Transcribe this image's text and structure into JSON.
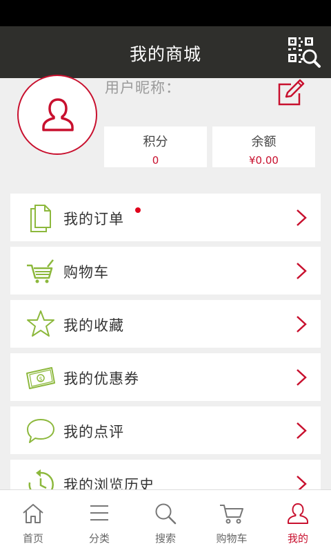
{
  "header": {
    "title": "我的商城"
  },
  "profile": {
    "nickname_label": "用户昵称："
  },
  "stats": {
    "points_label": "积分",
    "points_value": "0",
    "balance_label": "余额",
    "balance_value": "¥0.00"
  },
  "menu": {
    "items": [
      {
        "label": "我的订单",
        "icon": "order-document-icon",
        "has_badge": true
      },
      {
        "label": "购物车",
        "icon": "shopping-cart-icon"
      },
      {
        "label": "我的收藏",
        "icon": "star-icon"
      },
      {
        "label": "我的优惠券",
        "icon": "coupon-icon"
      },
      {
        "label": "我的点评",
        "icon": "speech-bubble-icon"
      },
      {
        "label": "我的浏览历史",
        "icon": "history-icon"
      }
    ]
  },
  "tabbar": {
    "tabs": [
      {
        "label": "首页",
        "icon": "home-icon"
      },
      {
        "label": "分类",
        "icon": "list-icon"
      },
      {
        "label": "搜索",
        "icon": "search-icon"
      },
      {
        "label": "购物车",
        "icon": "cart-icon"
      },
      {
        "label": "我的",
        "icon": "user-icon",
        "active": true
      }
    ]
  },
  "colors": {
    "accent": "#c8102e",
    "icon_green": "#8cb83c",
    "title_bar": "#2f2f2c",
    "background": "#efefef"
  }
}
